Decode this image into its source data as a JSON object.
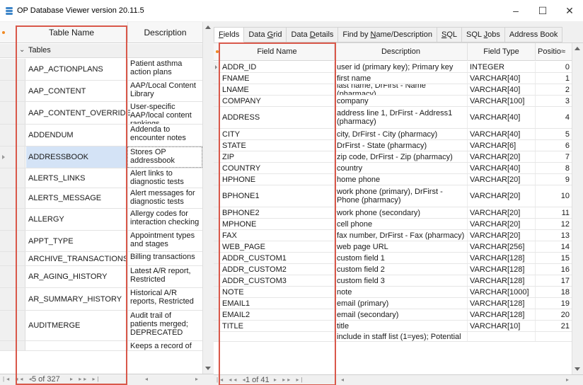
{
  "window": {
    "title": "OP Database Viewer  version 20.11.5",
    "minimize_glyph": "–",
    "maximize_glyph": "☐",
    "close_glyph": "✕"
  },
  "left_panel": {
    "columns": {
      "name": "Table Name",
      "description": "Description"
    },
    "group_label": "Tables",
    "rows": [
      {
        "name": "AAP_ACTIONPLANS",
        "description": "Patient asthma action plans"
      },
      {
        "name": "AAP_CONTENT",
        "description": "AAP/Local Content Library"
      },
      {
        "name": "AAP_CONTENT_OVERRIDE",
        "description": "User-specific AAP/local content rankings"
      },
      {
        "name": "ADDENDUM",
        "description": "Addenda to encounter notes"
      },
      {
        "name": "ADDRESSBOOK",
        "description": "Stores OP addressbook"
      },
      {
        "name": "ALERTS_LINKS",
        "description": "Alert links to diagnostic tests"
      },
      {
        "name": "ALERTS_MESSAGE",
        "description": "Alert messages for diagnostic tests"
      },
      {
        "name": "ALLERGY",
        "description": "Allergy codes for interaction checking"
      },
      {
        "name": "APPT_TYPE",
        "description": "Appointment types and stages"
      },
      {
        "name": "ARCHIVE_TRANSACTIONS",
        "description": "Billing transactions"
      },
      {
        "name": "AR_AGING_HISTORY",
        "description": "Latest A/R report, Restricted"
      },
      {
        "name": "AR_SUMMARY_HISTORY",
        "description": "Historical A/R reports, Restricted"
      },
      {
        "name": "AUDITMERGE",
        "description": "Audit trail of patients merged; DEPRECATED"
      },
      {
        "name": "",
        "description": "Keeps a record of"
      }
    ],
    "selected_index": 4,
    "nav": {
      "position": "5 of 327"
    }
  },
  "tabs": [
    {
      "pre": "",
      "u": "F",
      "post": "ields",
      "active": true
    },
    {
      "pre": "Data ",
      "u": "G",
      "post": "rid",
      "active": false
    },
    {
      "pre": "Data ",
      "u": "D",
      "post": "etails",
      "active": false
    },
    {
      "pre": "Find by ",
      "u": "N",
      "post": "ame/Description",
      "active": false
    },
    {
      "pre": "",
      "u": "S",
      "post": "QL",
      "active": false
    },
    {
      "pre": "SQL ",
      "u": "J",
      "post": "obs",
      "active": false
    },
    {
      "pre": "Address Book",
      "u": "",
      "post": "",
      "active": false
    }
  ],
  "fields_grid": {
    "columns": {
      "field_name": "Field Name",
      "description": "Description",
      "field_type": "Field Type",
      "position": "Positio≈"
    },
    "rows": [
      {
        "name": "ADDR_ID",
        "description": "user id (primary key); Primary key",
        "type": "INTEGER",
        "position": "0"
      },
      {
        "name": "FNAME",
        "description": "first name",
        "type": "VARCHAR[40]",
        "position": "1"
      },
      {
        "name": "LNAME",
        "description": "last name, DrFirst - Name (pharmacy)",
        "type": "VARCHAR[40]",
        "position": "2"
      },
      {
        "name": "COMPANY",
        "description": "company",
        "type": "VARCHAR[100]",
        "position": "3"
      },
      {
        "name": "ADDRESS",
        "description": "address line 1, DrFirst - Address1 (pharmacy)",
        "type": "VARCHAR[40]",
        "position": "4"
      },
      {
        "name": "CITY",
        "description": "city, DrFirst - City (pharmacy)",
        "type": "VARCHAR[40]",
        "position": "5"
      },
      {
        "name": "STATE",
        "description": "DrFirst - State (pharmacy)",
        "type": "VARCHAR[6]",
        "position": "6"
      },
      {
        "name": "ZIP",
        "description": "zip code, DrFirst - Zip (pharmacy)",
        "type": "VARCHAR[20]",
        "position": "7"
      },
      {
        "name": "COUNTRY",
        "description": "country",
        "type": "VARCHAR[40]",
        "position": "8"
      },
      {
        "name": "HPHONE",
        "description": "home phone",
        "type": "VARCHAR[20]",
        "position": "9"
      },
      {
        "name": "BPHONE1",
        "description": "work phone (primary), DrFirst - Phone (pharmacy)",
        "type": "VARCHAR[20]",
        "position": "10"
      },
      {
        "name": "BPHONE2",
        "description": "work phone (secondary)",
        "type": "VARCHAR[20]",
        "position": "11"
      },
      {
        "name": "MPHONE",
        "description": "cell phone",
        "type": "VARCHAR[20]",
        "position": "12"
      },
      {
        "name": "FAX",
        "description": "fax number, DrFirst - Fax (pharmacy)",
        "type": "VARCHAR[20]",
        "position": "13"
      },
      {
        "name": "WEB_PAGE",
        "description": "web page URL",
        "type": "VARCHAR[256]",
        "position": "14"
      },
      {
        "name": "ADDR_CUSTOM1",
        "description": "custom field 1",
        "type": "VARCHAR[128]",
        "position": "15"
      },
      {
        "name": "ADDR_CUSTOM2",
        "description": "custom field 2",
        "type": "VARCHAR[128]",
        "position": "16"
      },
      {
        "name": "ADDR_CUSTOM3",
        "description": "custom field 3",
        "type": "VARCHAR[128]",
        "position": "17"
      },
      {
        "name": "NOTE",
        "description": "note",
        "type": "VARCHAR[1000]",
        "position": "18"
      },
      {
        "name": "EMAIL1",
        "description": "email (primary)",
        "type": "VARCHAR[128]",
        "position": "19"
      },
      {
        "name": "EMAIL2",
        "description": "email (secondary)",
        "type": "VARCHAR[128]",
        "position": "20"
      },
      {
        "name": "TITLE",
        "description": "title",
        "type": "VARCHAR[10]",
        "position": "21"
      },
      {
        "name": "",
        "description": "include in staff list (1=yes); Potential",
        "type": "",
        "position": ""
      }
    ],
    "nav": {
      "position": "1 of 41"
    }
  },
  "colors": {
    "accent_highlight": "#d9584a",
    "selection": "#d4e3f6",
    "indicator": "#f08a24"
  },
  "icons": {
    "app": "database-icon",
    "collapse": "chevron-down-icon",
    "row": "row-pointer-icon"
  }
}
